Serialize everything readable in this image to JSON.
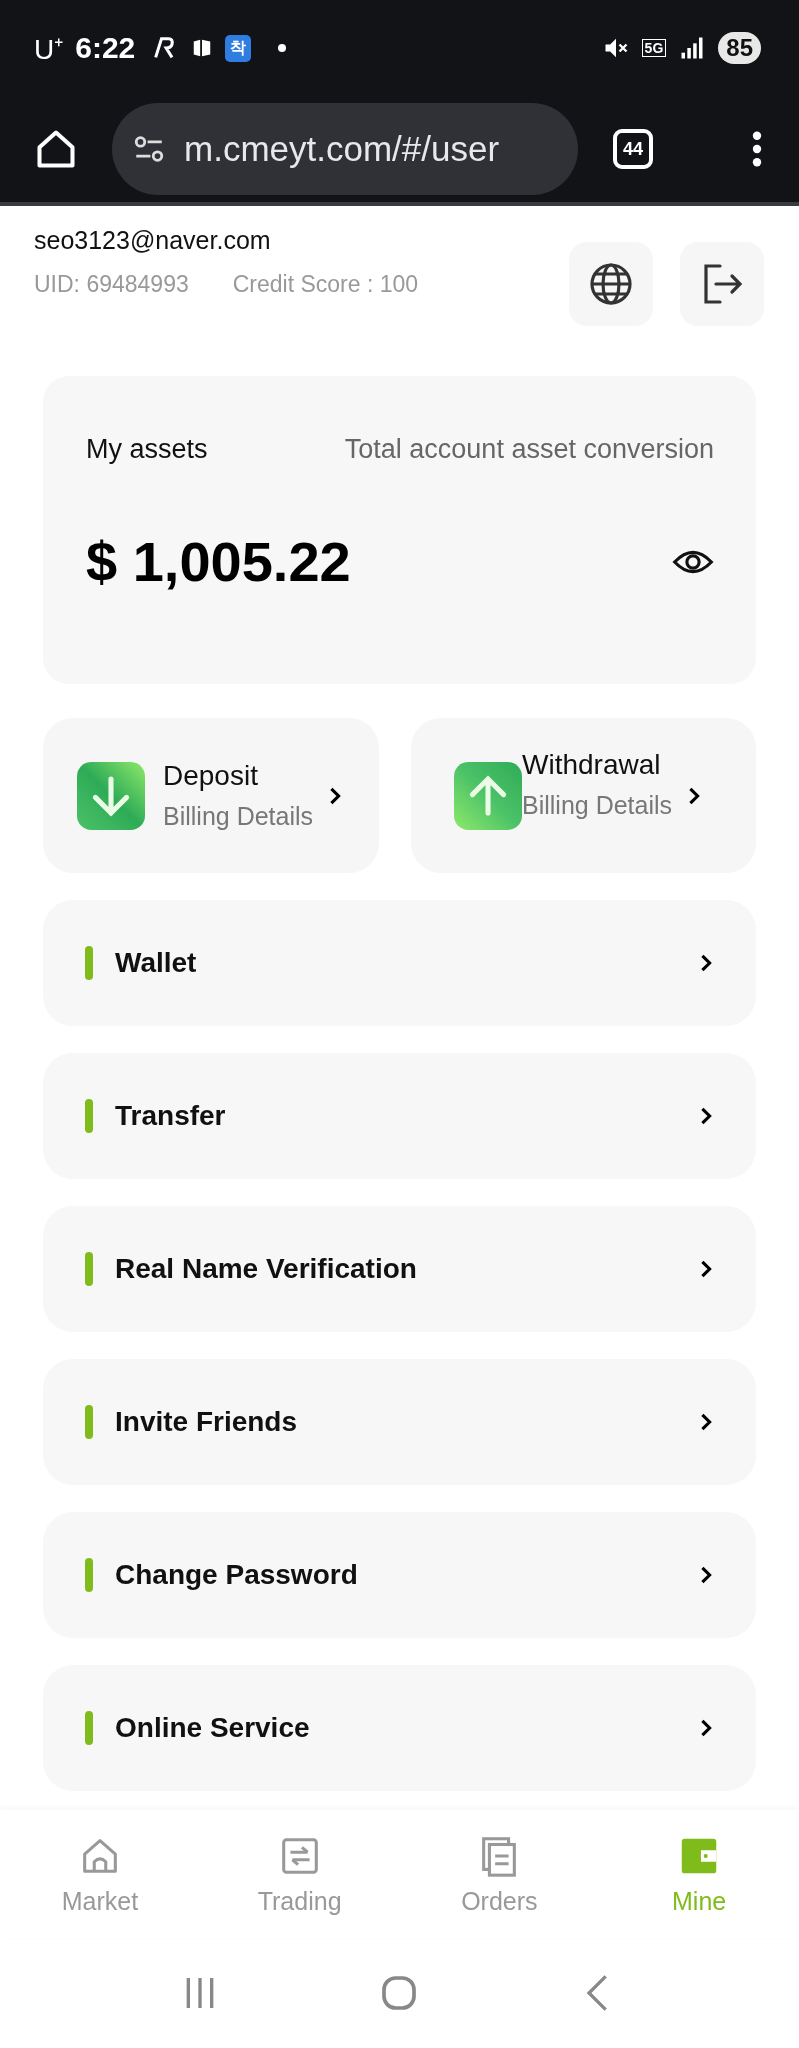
{
  "status_bar": {
    "carrier": "U⁺",
    "time": "6:22",
    "app_badge": "착",
    "network": "5G",
    "battery": "85"
  },
  "browser": {
    "url": "m.cmeyt.com/#/user",
    "tab_count": "44"
  },
  "user": {
    "email": "seo3123@naver.com",
    "uid": "UID: 69484993",
    "credit_score": "Credit Score : 100"
  },
  "assets": {
    "title": "My assets",
    "subtitle": "Total account asset conversion",
    "amount": "$ 1,005.22"
  },
  "actions": [
    {
      "kind": "deposit",
      "title": "Deposit",
      "subtitle": "Billing Details"
    },
    {
      "kind": "withdrawal",
      "title": "Withdrawal",
      "subtitle": "Billing Details"
    }
  ],
  "menu": [
    {
      "label": "Wallet"
    },
    {
      "label": "Transfer"
    },
    {
      "label": "Real Name Verification"
    },
    {
      "label": "Invite Friends"
    },
    {
      "label": "Change Password"
    },
    {
      "label": "Online Service"
    }
  ],
  "tab_bar": [
    {
      "kind": "market",
      "label": "Market",
      "selected": false
    },
    {
      "kind": "trading",
      "label": "Trading",
      "selected": false
    },
    {
      "kind": "orders",
      "label": "Orders",
      "selected": false
    },
    {
      "kind": "mine",
      "label": "Mine",
      "selected": true
    }
  ]
}
